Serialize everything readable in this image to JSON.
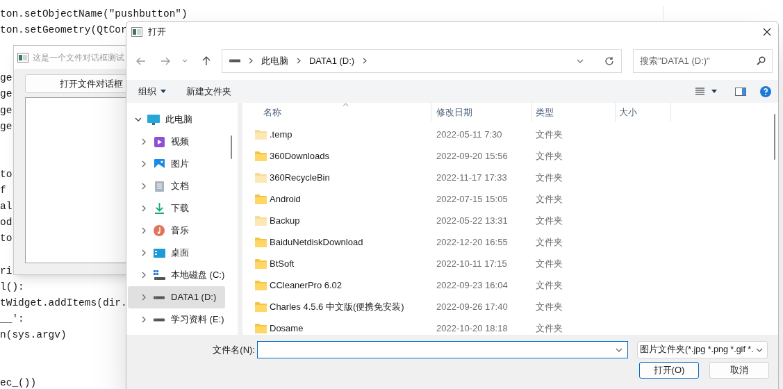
{
  "editor": {
    "blocks": [
      {
        "lines": [
          "ton.setObjectName(\"pushbutton\")",
          "ton.setGeometry(QtCor"
        ]
      },
      {
        "lines": [
          "ge",
          "ge",
          "ge",
          "ge"
        ]
      },
      {
        "lines": [
          "to",
          "f",
          "al",
          "od",
          "to"
        ]
      },
      {
        "lines": [
          "ri",
          "l():",
          "tWidget.addItems(dir.",
          "__':",
          "n(sys.argv)"
        ]
      },
      {
        "lines": [
          "ec_())"
        ]
      }
    ]
  },
  "small_window": {
    "title": "这是一个文件对话框测试",
    "button": "打开文件对话框"
  },
  "dialog": {
    "title": "打开",
    "address": {
      "crumbs": [
        "此电脑",
        "DATA1 (D:)"
      ]
    },
    "search": {
      "placeholder": "搜索\"DATA1 (D:)\""
    },
    "toolbar": {
      "organize": "组织",
      "new_folder": "新建文件夹"
    },
    "tree": [
      {
        "label": "此电脑",
        "kind": "pc",
        "expanded": true,
        "selected": false,
        "children": [
          {
            "label": "视频",
            "kind": "video",
            "expanded": false,
            "selected": false
          },
          {
            "label": "图片",
            "kind": "pictures",
            "expanded": false,
            "selected": false
          },
          {
            "label": "文档",
            "kind": "documents",
            "expanded": false,
            "selected": false
          },
          {
            "label": "下载",
            "kind": "downloads",
            "expanded": false,
            "selected": false
          },
          {
            "label": "音乐",
            "kind": "music",
            "expanded": false,
            "selected": false
          },
          {
            "label": "桌面",
            "kind": "desktop",
            "expanded": false,
            "selected": false
          },
          {
            "label": "本地磁盘 (C:)",
            "kind": "system_drive",
            "expanded": false,
            "selected": false
          },
          {
            "label": "DATA1 (D:)",
            "kind": "drive",
            "expanded": false,
            "selected": true
          },
          {
            "label": "学习资料 (E:)",
            "kind": "drive",
            "expanded": false,
            "selected": false
          }
        ]
      }
    ],
    "columns": [
      "名称",
      "修改日期",
      "类型",
      "大小"
    ],
    "rows": [
      {
        "name": ".temp",
        "date": "2022-05-11 7:30",
        "type": "文件夹",
        "dimmed": true
      },
      {
        "name": "360Downloads",
        "date": "2022-09-20 15:56",
        "type": "文件夹",
        "dimmed": false
      },
      {
        "name": "360RecycleBin",
        "date": "2022-11-17 17:33",
        "type": "文件夹",
        "dimmed": true
      },
      {
        "name": "Android",
        "date": "2022-07-15 15:05",
        "type": "文件夹",
        "dimmed": false
      },
      {
        "name": "Backup",
        "date": "2022-05-22 13:31",
        "type": "文件夹",
        "dimmed": true
      },
      {
        "name": "BaiduNetdiskDownload",
        "date": "2022-12-20 16:55",
        "type": "文件夹",
        "dimmed": false
      },
      {
        "name": "BtSoft",
        "date": "2022-10-11 17:15",
        "type": "文件夹",
        "dimmed": false
      },
      {
        "name": "CCleanerPro 6.02",
        "date": "2022-09-23 16:04",
        "type": "文件夹",
        "dimmed": false
      },
      {
        "name": "Charles 4.5.6 中文版(便携免安装)",
        "date": "2022-09-26 17:40",
        "type": "文件夹",
        "dimmed": false
      },
      {
        "name": "Dosame",
        "date": "2022-10-20 18:18",
        "type": "文件夹",
        "dimmed": false
      }
    ],
    "filename": {
      "label": "文件名(N):"
    },
    "filter": "图片文件夹(*.jpg *.png *.gif *.",
    "buttons": [
      {
        "label": "打开(O)",
        "default": true
      },
      {
        "label": "取消",
        "default": false
      }
    ]
  }
}
